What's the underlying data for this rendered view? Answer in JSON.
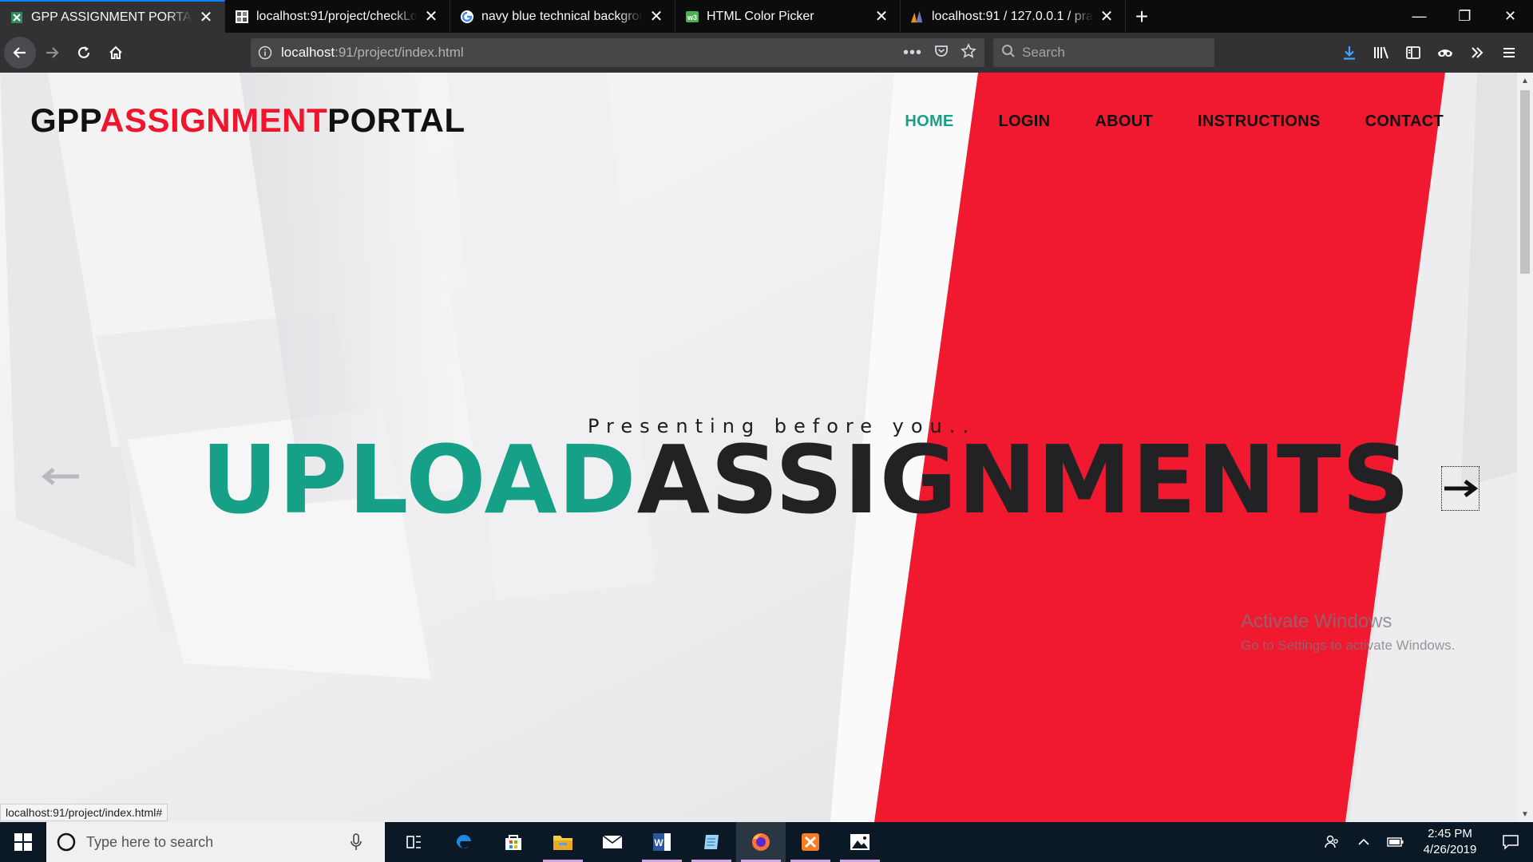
{
  "browser": {
    "tabs": [
      {
        "title": "GPP ASSIGNMENT PORTAL",
        "icon": "x-favicon-icon",
        "active": true
      },
      {
        "title": "localhost:91/project/checkLogin",
        "icon": "page-favicon-icon",
        "active": false
      },
      {
        "title": "navy blue technical background",
        "icon": "google-icon",
        "active": false
      },
      {
        "title": "HTML Color Picker",
        "icon": "w3schools-icon",
        "active": false
      },
      {
        "title": "localhost:91 / 127.0.0.1 / practice",
        "icon": "phpmyadmin-icon",
        "active": false
      }
    ],
    "url_host": "localhost",
    "url_rest": ":91/project/index.html",
    "search_placeholder": "Search",
    "status_link": "localhost:91/project/index.html#"
  },
  "site": {
    "brand_part1": "GPP",
    "brand_part2": "ASSIGNMENT",
    "brand_part3": "PORTAL",
    "menu": [
      {
        "label": "HOME",
        "active": true
      },
      {
        "label": "LOGIN",
        "active": false
      },
      {
        "label": "ABOUT",
        "active": false
      },
      {
        "label": "INSTRUCTIONS",
        "active": false
      },
      {
        "label": "CONTACT",
        "active": false
      }
    ],
    "tagline": "Presenting before you..",
    "headline_part1": "UPLOAD",
    "headline_part2": "ASSIGNMENTS",
    "colors": {
      "accent_green": "#17a088",
      "accent_red": "#f0152d",
      "dark": "#222224"
    }
  },
  "watermark": {
    "title": "Activate Windows",
    "subtitle": "Go to Settings to activate Windows."
  },
  "taskbar": {
    "search_placeholder": "Type here to search",
    "apps": [
      "edge-icon",
      "store-icon",
      "file-explorer-icon",
      "mail-icon",
      "word-icon",
      "notepad-icon",
      "firefox-icon",
      "xampp-icon",
      "photos-icon"
    ],
    "time": "2:45 PM",
    "date": "4/26/2019"
  }
}
